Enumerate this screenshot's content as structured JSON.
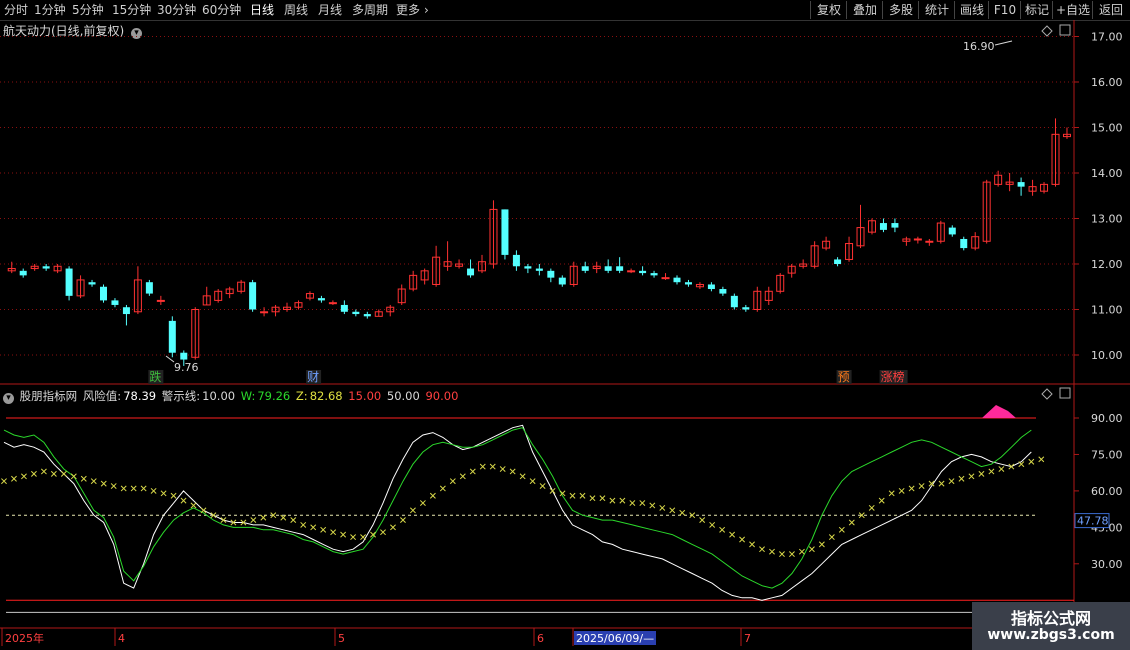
{
  "toolbar": {
    "periods": [
      "分时",
      "1分钟",
      "5分钟",
      "15分钟",
      "30分钟",
      "60分钟",
      "日线",
      "周线",
      "月线",
      "多周期",
      "更多"
    ],
    "active_period": "日线",
    "right_buttons": [
      "复权",
      "叠加",
      "多股",
      "统计",
      "画线",
      "F10",
      "标记",
      "+自选",
      "返回"
    ]
  },
  "main": {
    "title": "航天动力(日线,前复权)",
    "high_label": "16.90",
    "low_label": "9.76",
    "markers": [
      {
        "text": "跌",
        "color": "#3dbb3d",
        "day": 10
      },
      {
        "text": "财",
        "color": "#6fa0ff",
        "day": 21
      },
      {
        "text": "预",
        "color": "#ff7a1a",
        "day": 58
      },
      {
        "text": "涨榜",
        "color": "#ff4040",
        "day": 61
      }
    ]
  },
  "indicator": {
    "name": "股朋指标网",
    "fxz_label": "风险值:",
    "fxz_value": "78.39",
    "jsx_label": "警示线:",
    "jsx_value": "10.00",
    "w_label": "W:",
    "w_value": "79.26",
    "z_label": "Z:",
    "z_value": "82.68",
    "lvl1": "15.00",
    "lvl2": "50.00",
    "lvl3": "90.00",
    "current_label": "47.78"
  },
  "colors": {
    "up": "#ff3232",
    "down": "#54ffff",
    "grid": "#8a1010",
    "ma_white": "#ffffff",
    "ma_green": "#2bd82b",
    "cross": "#d8d84a"
  },
  "chart_data": [
    {
      "type": "candlestick",
      "title": "航天动力(日线,前复权)",
      "ylim": [
        9.6,
        17.2
      ],
      "yticks": [
        10.0,
        11.0,
        12.0,
        13.0,
        14.0,
        15.0,
        16.0,
        17.0
      ],
      "x_labels": [
        {
          "text": "2025年",
          "day": 0
        },
        {
          "text": "4",
          "day": 8
        },
        {
          "text": "5",
          "day": 23
        },
        {
          "text": "6",
          "day": 37
        },
        {
          "text": "2025/06/09/—",
          "day": 40
        },
        {
          "text": "7",
          "day": 51
        }
      ],
      "candles": [
        [
          11.85,
          11.9,
          11.8,
          12.05
        ],
        [
          11.85,
          11.75,
          11.7,
          11.9
        ],
        [
          11.9,
          11.95,
          11.85,
          12.0
        ],
        [
          11.95,
          11.9,
          11.85,
          12.0
        ],
        [
          11.85,
          11.95,
          11.8,
          12.0
        ],
        [
          11.9,
          11.3,
          11.2,
          11.95
        ],
        [
          11.3,
          11.65,
          11.25,
          11.75
        ],
        [
          11.6,
          11.55,
          11.5,
          11.65
        ],
        [
          11.5,
          11.2,
          11.15,
          11.55
        ],
        [
          11.2,
          11.1,
          11.05,
          11.25
        ],
        [
          11.05,
          10.9,
          10.65,
          11.1
        ],
        [
          10.95,
          11.65,
          10.9,
          11.95
        ],
        [
          11.6,
          11.35,
          11.3,
          11.65
        ],
        [
          11.2,
          11.2,
          11.1,
          11.3
        ],
        [
          10.75,
          10.05,
          9.95,
          10.85
        ],
        [
          10.05,
          9.9,
          9.76,
          10.1
        ],
        [
          9.95,
          11.0,
          9.9,
          11.05
        ],
        [
          11.1,
          11.3,
          11.1,
          11.5
        ],
        [
          11.2,
          11.4,
          11.15,
          11.45
        ],
        [
          11.35,
          11.45,
          11.25,
          11.5
        ],
        [
          11.4,
          11.6,
          11.35,
          11.65
        ],
        [
          11.6,
          11.0,
          10.95,
          11.65
        ],
        [
          10.95,
          10.95,
          10.85,
          11.05
        ],
        [
          10.95,
          11.05,
          10.85,
          11.1
        ],
        [
          11.0,
          11.05,
          10.95,
          11.15
        ],
        [
          11.05,
          11.15,
          11.0,
          11.2
        ],
        [
          11.25,
          11.35,
          11.2,
          11.4
        ],
        [
          11.25,
          11.2,
          11.15,
          11.3
        ],
        [
          11.15,
          11.15,
          11.1,
          11.2
        ],
        [
          11.1,
          10.95,
          10.9,
          11.2
        ],
        [
          10.95,
          10.9,
          10.85,
          11.0
        ],
        [
          10.9,
          10.85,
          10.8,
          10.95
        ],
        [
          10.85,
          10.95,
          10.85,
          11.0
        ],
        [
          10.95,
          11.05,
          10.85,
          11.1
        ],
        [
          11.15,
          11.45,
          11.1,
          11.55
        ],
        [
          11.45,
          11.75,
          11.4,
          11.85
        ],
        [
          11.65,
          11.85,
          11.55,
          11.9
        ],
        [
          11.55,
          12.15,
          11.5,
          12.4
        ],
        [
          11.95,
          12.05,
          11.85,
          12.5
        ],
        [
          11.95,
          12.0,
          11.9,
          12.1
        ],
        [
          11.9,
          11.75,
          11.7,
          12.1
        ],
        [
          11.85,
          12.05,
          11.8,
          12.2
        ],
        [
          12.0,
          13.2,
          11.9,
          13.4
        ]
      ]
    },
    {
      "type": "line",
      "title": "股朋指标网",
      "ylim": [
        10,
        100
      ],
      "yticks": [
        30.0,
        45.0,
        60.0,
        75.0,
        90.0
      ],
      "ref_lines": [
        90,
        50,
        15,
        10
      ],
      "series": [
        {
          "name": "W",
          "color": "#ffffff",
          "values": [
            80,
            78,
            79,
            78,
            76,
            71,
            67,
            63,
            56,
            50,
            47,
            38,
            22,
            20,
            30,
            42,
            50,
            55,
            60,
            56,
            52,
            50,
            48,
            47,
            47,
            46,
            46,
            45,
            44,
            43,
            42,
            40,
            38,
            36,
            35,
            36,
            39,
            46,
            55,
            65,
            73,
            80,
            83,
            84,
            82,
            79,
            77,
            78,
            80,
            82,
            84,
            86,
            87,
            76,
            68,
            60,
            52,
            46,
            44,
            42,
            39,
            38,
            36,
            35,
            34,
            33,
            32,
            30,
            28,
            26,
            24,
            22,
            19,
            17,
            16,
            16,
            15,
            16,
            17,
            20,
            23,
            26,
            30,
            34,
            38,
            40,
            42,
            44,
            46,
            48,
            50,
            52,
            56,
            62,
            68,
            72,
            74,
            75,
            74,
            72,
            71,
            70,
            72,
            76,
            80,
            84,
            86,
            87,
            88,
            88,
            87,
            87,
            88,
            90,
            92,
            93,
            93,
            92,
            90,
            88,
            84,
            80
          ]
        },
        {
          "name": "Z",
          "color": "#2bd82b",
          "values": [
            85,
            83,
            82,
            83,
            80,
            74,
            69,
            66,
            59,
            52,
            49,
            41,
            27,
            23,
            29,
            37,
            43,
            48,
            51,
            53,
            51,
            48,
            46,
            45,
            45,
            45,
            44,
            44,
            43,
            42,
            40,
            39,
            37,
            35,
            34,
            35,
            36,
            41,
            48,
            56,
            64,
            71,
            76,
            79,
            80,
            79,
            78,
            78,
            79,
            81,
            83,
            85,
            86,
            79,
            73,
            66,
            58,
            52,
            50,
            49,
            48,
            48,
            47,
            46,
            45,
            44,
            43,
            42,
            40,
            38,
            36,
            34,
            31,
            28,
            25,
            23,
            21,
            20,
            22,
            26,
            32,
            40,
            50,
            58,
            64,
            68,
            70,
            72,
            74,
            76,
            78,
            80,
            81,
            80,
            78,
            76,
            74,
            72,
            70,
            71,
            74,
            78,
            82,
            85,
            87,
            88,
            88,
            88,
            88,
            88,
            87,
            87,
            88,
            90,
            92,
            93,
            93,
            92,
            90,
            88,
            86,
            83
          ]
        },
        {
          "name": "cross",
          "color": "#d8d84a",
          "values": [
            64,
            65,
            66,
            67,
            68,
            67,
            67,
            66,
            65,
            64,
            63,
            62,
            61,
            61,
            61,
            60,
            59,
            58,
            56,
            54,
            52,
            50,
            48,
            47,
            47,
            48,
            49,
            50,
            49,
            48,
            46,
            45,
            44,
            43,
            42,
            41,
            41,
            42,
            43,
            45,
            48,
            52,
            55,
            58,
            61,
            64,
            66,
            68,
            70,
            70,
            69,
            68,
            66,
            64,
            62,
            60,
            59,
            58,
            58,
            57,
            57,
            56,
            56,
            55,
            55,
            54,
            53,
            52,
            51,
            50,
            48,
            46,
            44,
            42,
            40,
            38,
            36,
            35,
            34,
            34,
            35,
            36,
            38,
            41,
            44,
            47,
            50,
            53,
            56,
            59,
            60,
            61,
            62,
            63,
            63,
            64,
            65,
            66,
            67,
            68,
            69,
            70,
            71,
            72,
            73,
            74,
            75,
            76,
            77,
            78,
            79,
            80,
            81,
            82,
            83,
            84,
            84,
            84,
            83,
            82,
            81,
            80
          ]
        }
      ]
    }
  ],
  "watermark": {
    "title": "指标公式网",
    "url": "www.zbgs3.com"
  }
}
